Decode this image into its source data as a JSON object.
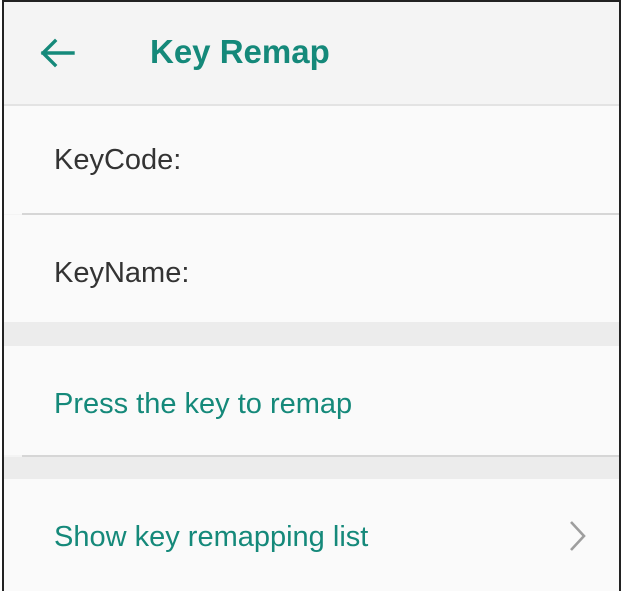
{
  "header": {
    "title": "Key Remap",
    "back_icon": "arrow-left-icon"
  },
  "info": {
    "keycode_label": "KeyCode:",
    "keyname_label": "KeyName:"
  },
  "actions": {
    "press_key_label": "Press the key to remap",
    "show_list_label": "Show key remapping list",
    "chevron_icon": "chevron-right-icon"
  },
  "colors": {
    "accent": "#15897a",
    "text_primary": "#333333",
    "chevron": "#9e9e9e",
    "background": "#f4f4f4"
  }
}
